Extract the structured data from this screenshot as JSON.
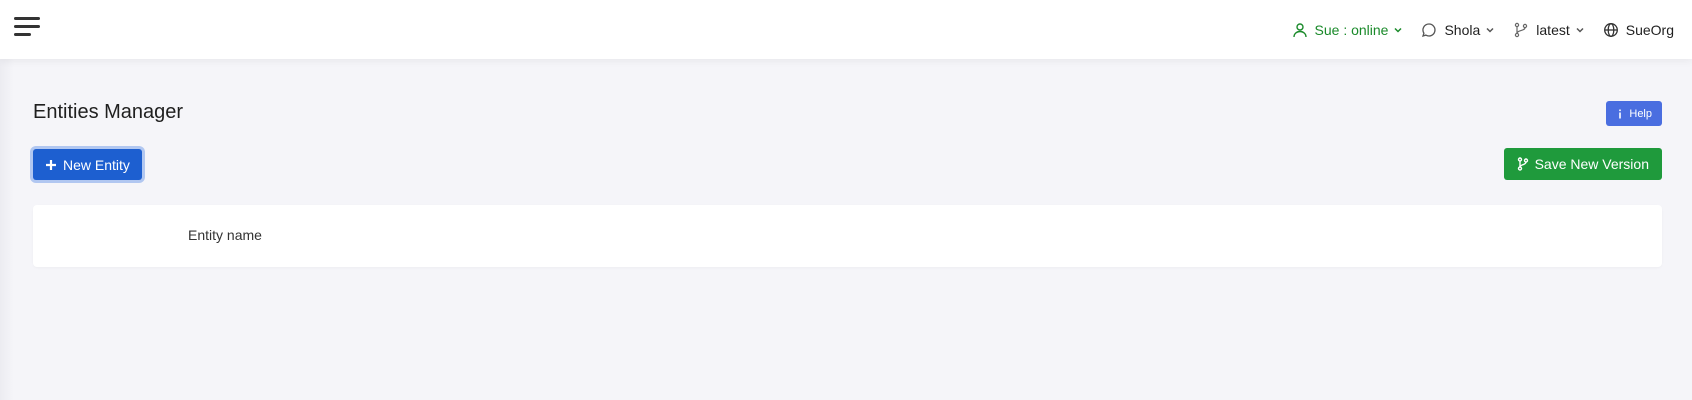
{
  "header": {
    "menu_icon": "hamburger-menu-icon",
    "user": {
      "label": "Sue : online",
      "icon": "user-icon",
      "color": "#1a8a2a"
    },
    "chat": {
      "label": "Shola",
      "icon": "chat-bubble-icon"
    },
    "branch": {
      "label": "latest",
      "icon": "git-branch-icon"
    },
    "org": {
      "label": "SueOrg",
      "icon": "globe-icon"
    }
  },
  "page": {
    "title": "Entities Manager",
    "help_label": "Help",
    "help_color": "#4a6ee0",
    "new_entity_label": "New Entity",
    "new_entity_color": "#1d5fd0",
    "save_version_label": "Save New Version",
    "save_version_color": "#1f9a3c"
  },
  "table": {
    "columns": [
      "Entity name"
    ],
    "rows": []
  }
}
